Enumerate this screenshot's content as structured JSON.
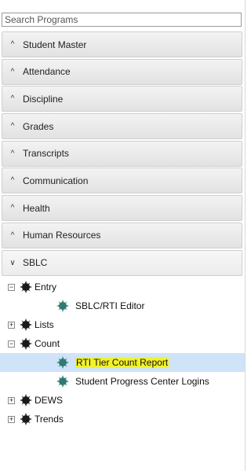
{
  "search": {
    "placeholder": "Search Programs"
  },
  "accordion": [
    {
      "label": "Student Master",
      "chevron": "up"
    },
    {
      "label": "Attendance",
      "chevron": "up"
    },
    {
      "label": "Discipline",
      "chevron": "up"
    },
    {
      "label": "Grades",
      "chevron": "up"
    },
    {
      "label": "Transcripts",
      "chevron": "up"
    },
    {
      "label": "Communication",
      "chevron": "up"
    },
    {
      "label": "Health",
      "chevron": "up"
    },
    {
      "label": "Human Resources",
      "chevron": "up"
    },
    {
      "label": "SBLC",
      "chevron": "down"
    }
  ],
  "tree": {
    "entry": {
      "label": "Entry",
      "toggle": "−"
    },
    "sblc_rti_editor": {
      "label": "SBLC/RTI Editor"
    },
    "lists": {
      "label": "Lists",
      "toggle": "+"
    },
    "count": {
      "label": "Count",
      "toggle": "−"
    },
    "rti_tier_count_report": {
      "label": "RTI Tier Count Report",
      "highlight": "#f2f22b",
      "selected_bg": "#cfe3f9"
    },
    "student_progress_center_logins": {
      "label": "Student Progress Center Logins"
    },
    "dews": {
      "label": "DEWS",
      "toggle": "+"
    },
    "trends": {
      "label": "Trends",
      "toggle": "+"
    }
  },
  "icons": {
    "toggle_icon": "square-plus-minus",
    "node_icon": "gear-icon",
    "folder_color": "#1a1a1a",
    "leaf_color": "#2f7a72"
  }
}
